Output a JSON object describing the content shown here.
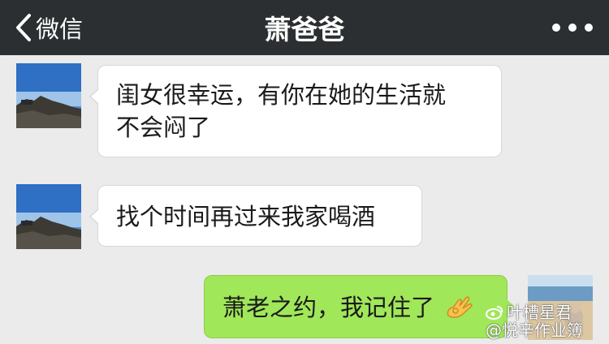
{
  "header": {
    "back_label": "微信",
    "title": "萧爸爸",
    "more_icon": "more-dots-icon"
  },
  "messages": [
    {
      "side": "incoming",
      "lines": [
        "闺女很幸运，有你在她的生活就",
        "不会闷了"
      ]
    },
    {
      "side": "incoming",
      "lines": [
        "找个时间再过来我家喝酒"
      ]
    },
    {
      "side": "outgoing",
      "lines": [
        "萧老之约，我记住了"
      ],
      "emoji": "ok-hand-emoji"
    }
  ],
  "watermark": {
    "line1": "叶槽星君",
    "line2": "@悦辛作业簿"
  },
  "colors": {
    "topbar": "#2b2f31",
    "background": "#ebebeb",
    "incoming_bubble": "#ffffff",
    "outgoing_bubble": "#a0e75a"
  }
}
